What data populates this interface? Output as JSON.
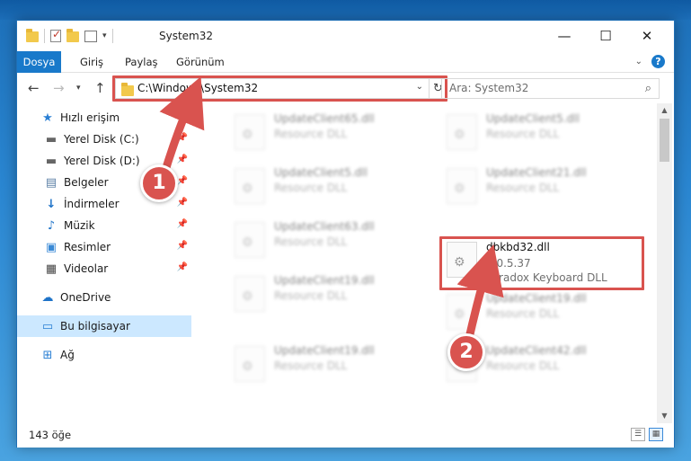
{
  "window": {
    "title": "System32",
    "controls": {
      "minimize": "—",
      "maximize": "☐",
      "close": "✕"
    }
  },
  "ribbon": {
    "tabs": [
      "Dosya",
      "Giriş",
      "Paylaş",
      "Görünüm"
    ],
    "expand_icon": "chevron-down-icon",
    "help": "?"
  },
  "address": {
    "path": "C:\\Windows\\System32",
    "search_placeholder": "Ara: System32"
  },
  "sidebar": {
    "items": [
      {
        "label": "Hızlı erişim",
        "icon": "star-icon",
        "pinned": false
      },
      {
        "label": "Yerel Disk (C:)",
        "icon": "drive-icon",
        "pinned": true
      },
      {
        "label": "Yerel Disk (D:)",
        "icon": "drive-icon",
        "pinned": true
      },
      {
        "label": "Belgeler",
        "icon": "document-icon",
        "pinned": true
      },
      {
        "label": "İndirmeler",
        "icon": "download-icon",
        "pinned": true
      },
      {
        "label": "Müzik",
        "icon": "music-icon",
        "pinned": true
      },
      {
        "label": "Resimler",
        "icon": "pictures-icon",
        "pinned": true
      },
      {
        "label": "Videolar",
        "icon": "video-icon",
        "pinned": true
      },
      {
        "label": "OneDrive",
        "icon": "cloud-icon",
        "pinned": false
      },
      {
        "label": "Bu bilgisayar",
        "icon": "computer-icon",
        "pinned": false,
        "selected": true
      },
      {
        "label": "Ağ",
        "icon": "network-icon",
        "pinned": false
      }
    ]
  },
  "files": [
    {
      "name": "UpdateClient65.dll",
      "type": "Resource DLL"
    },
    {
      "name": "UpdateClient5.dll",
      "type": "Resource DLL"
    },
    {
      "name": "UpdateClient5.dll",
      "type": "Resource DLL"
    },
    {
      "name": "UpdateClient21.dll",
      "type": "Resource DLL"
    },
    {
      "name": "UpdateClient63.dll",
      "type": "Resource DLL"
    },
    {
      "name": "UpdateClient19.dll",
      "type": "Resource DLL"
    },
    {
      "name": "UpdateClient19.dll",
      "type": "Resource DLL"
    },
    {
      "name": "UpdateClient19.dll",
      "type": "Resource DLL"
    },
    {
      "name": "UpdateClient42.dll",
      "type": "Resource DLL"
    }
  ],
  "highlighted_file": {
    "name": "dbkbd32.dll",
    "version": "7.0.5.37",
    "description": "Paradox Keyboard DLL"
  },
  "status": {
    "count": "143 öğe"
  },
  "callouts": {
    "one": "1",
    "two": "2"
  },
  "colors": {
    "accent": "#1979ca",
    "highlight": "#d9534f",
    "selected": "#cce8ff"
  }
}
